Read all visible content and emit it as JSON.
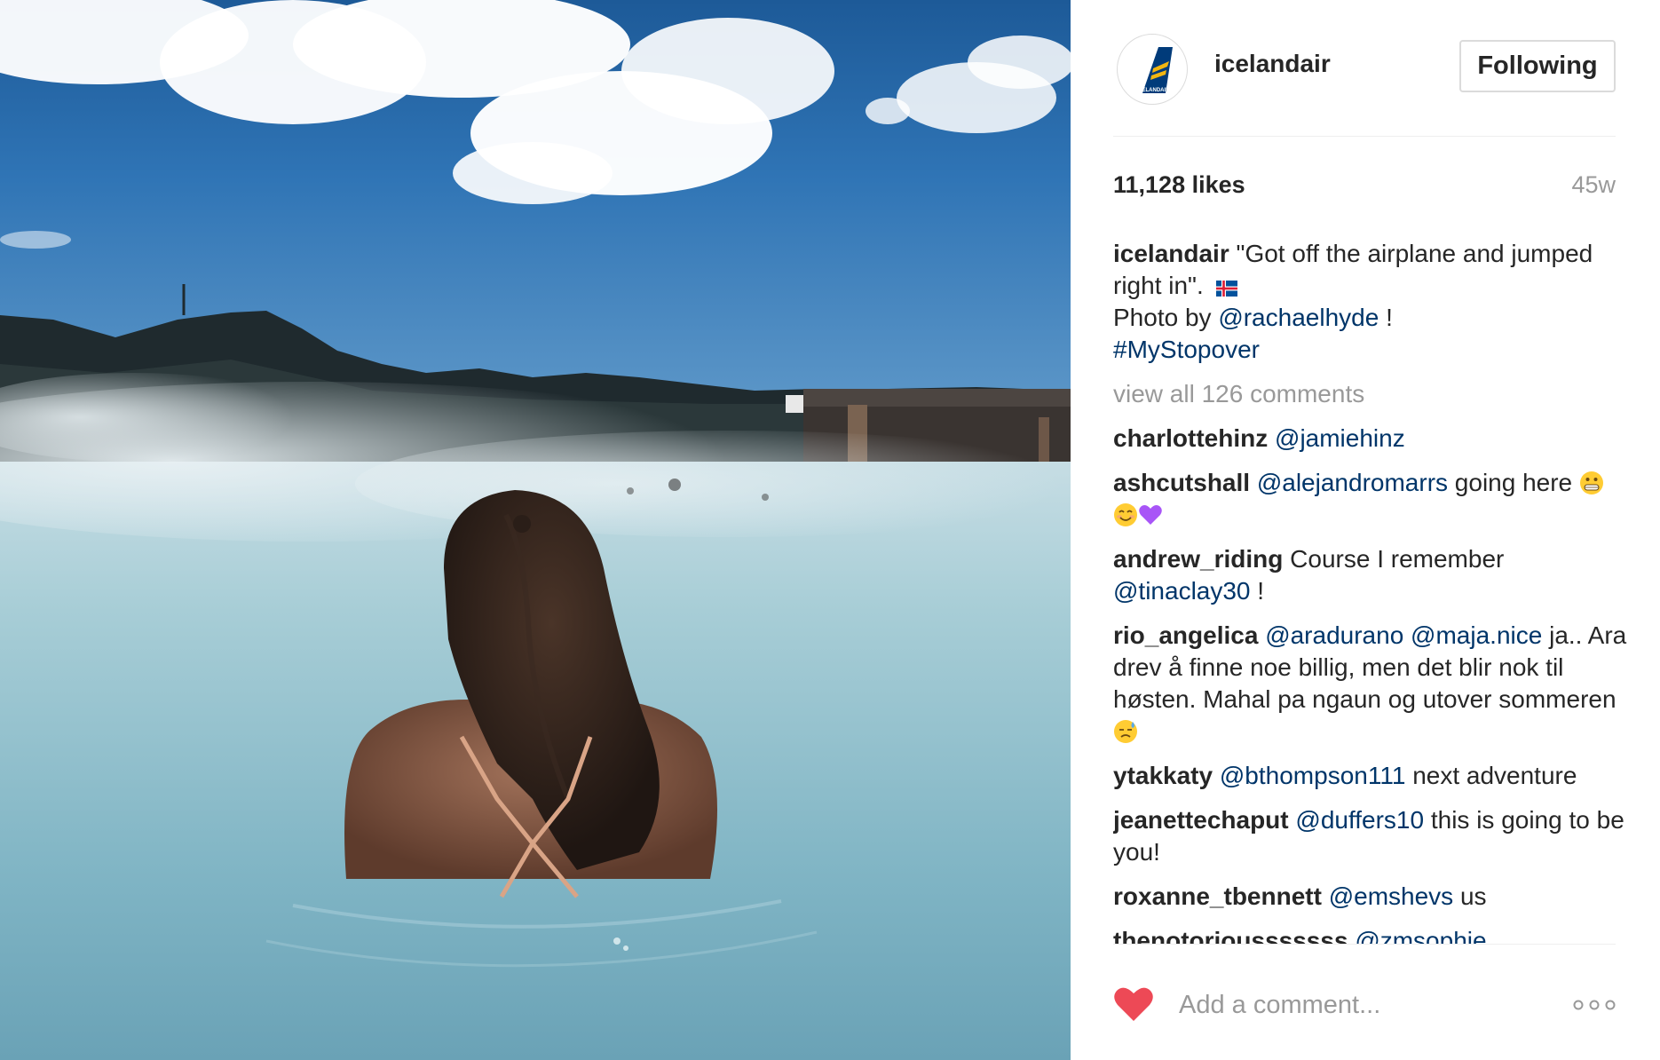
{
  "post": {
    "image_alt": "Woman bathing in the steaming Blue Lagoon under a blue sky",
    "account": {
      "username": "icelandair",
      "avatar_icon": "icelandair-tail-logo-icon",
      "avatar_text": "ICELANDAIR",
      "follow_label": "Following"
    },
    "likes_label": "11,128 likes",
    "age_label": "45w",
    "caption": {
      "username": "icelandair",
      "text": "\"Got off the airplane and jumped right in\".",
      "flag_icon": "iceland-flag-icon",
      "credit_prefix": "Photo by",
      "credit_mention": "@rachaelhyde",
      "credit_suffix": "!",
      "hashtag": "#MyStopover"
    },
    "view_all_label": "view all 126 comments",
    "comments": [
      {
        "username": "charlottehinz",
        "mentions": [
          "@jamiehinz"
        ],
        "text": ""
      },
      {
        "username": "ashcutshall",
        "mentions": [
          "@alejandromarrs"
        ],
        "text": "going here",
        "emoji_icons": [
          "grimacing-face-icon",
          "smiling-face-icon",
          "purple-heart-icon"
        ]
      },
      {
        "username": "andrew_riding",
        "text": "Course I remember",
        "mentions": [
          "@tinaclay30"
        ],
        "suffix": "!"
      },
      {
        "username": "rio_angelica",
        "mentions": [
          "@aradurano",
          "@maja.nice"
        ],
        "text": "ja.. Ara drev å finne noe billig, men det blir nok til høsten. Mahal pa ngaun og utover sommeren",
        "emoji_icons": [
          "sweat-face-icon"
        ]
      },
      {
        "username": "ytakkaty",
        "mentions": [
          "@bthompson111"
        ],
        "text": "next adventure"
      },
      {
        "username": "jeanettechaput",
        "mentions": [
          "@duffers10"
        ],
        "text": "this is going to be you!"
      },
      {
        "username": "roxanne_tbennett",
        "mentions": [
          "@emshevs"
        ],
        "text": "us"
      },
      {
        "username": "thenotoriousssssss",
        "mentions": [
          "@zmsophie"
        ],
        "text": ""
      }
    ],
    "actions": {
      "like_icon": "heart-icon",
      "like_color": "#ed4956",
      "comment_placeholder": "Add a comment...",
      "more_icon": "more-options-icon"
    }
  },
  "colors": {
    "text": "#262626",
    "mention": "#003569",
    "muted": "#999999",
    "divider": "#efefef",
    "border": "#dbdbdb"
  }
}
